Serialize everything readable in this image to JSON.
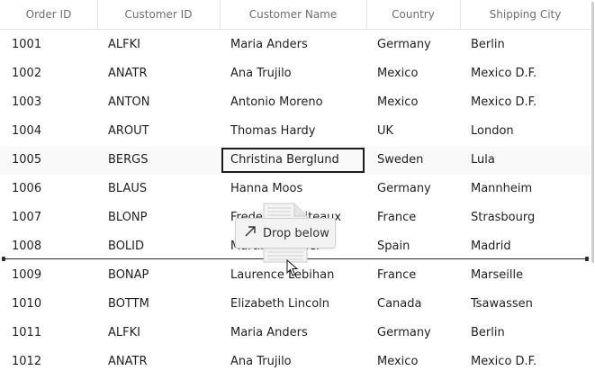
{
  "columns": [
    "Order ID",
    "Customer ID",
    "Customer Name",
    "Country",
    "Shipping City"
  ],
  "rows": [
    [
      "1001",
      "ALFKI",
      "Maria Anders",
      "Germany",
      "Berlin"
    ],
    [
      "1002",
      "ANATR",
      "Ana Trujilo",
      "Mexico",
      "Mexico D.F."
    ],
    [
      "1003",
      "ANTON",
      "Antonio Moreno",
      "Mexico",
      "Mexico D.F."
    ],
    [
      "1004",
      "AROUT",
      "Thomas Hardy",
      "UK",
      "London"
    ],
    [
      "1005",
      "BERGS",
      "Christina Berglund",
      "Sweden",
      "Lula"
    ],
    [
      "1006",
      "BLAUS",
      "Hanna Moos",
      "Germany",
      "Mannheim"
    ],
    [
      "1007",
      "BLONP",
      "Frederique Citeaux",
      "France",
      "Strasbourg"
    ],
    [
      "1008",
      "BOLID",
      "Martin Sommer",
      "Spain",
      "Madrid"
    ],
    [
      "1009",
      "BONAP",
      "Laurence Lebihan",
      "France",
      "Marseille"
    ],
    [
      "1010",
      "BOTTM",
      "Elizabeth Lincoln",
      "Canada",
      "Tsawassen"
    ],
    [
      "1011",
      "ALFKI",
      "Maria Anders",
      "Germany",
      "Berlin"
    ],
    [
      "1012",
      "ANATR",
      "Ana Trujilo",
      "Mexico",
      "Mexico D.F."
    ]
  ],
  "selected_row": 4,
  "selected_col": 2,
  "drag_tooltip": {
    "label": "Drop below",
    "icon": "arrow-up-right-icon"
  },
  "colors": {
    "header_text": "#6e6e6e",
    "selection_border": "#1b1b1b",
    "drop_indicator": "#2b2b2b"
  }
}
